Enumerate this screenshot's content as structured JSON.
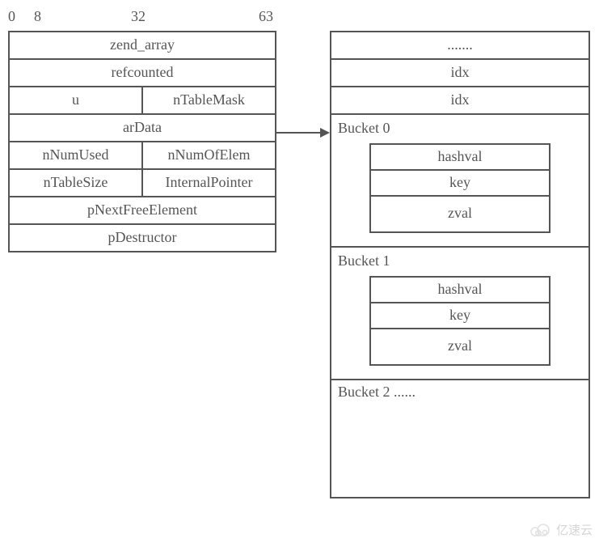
{
  "bit_labels": {
    "b0": "0",
    "b8": "8",
    "b32": "32",
    "b63": "63"
  },
  "zend_array": {
    "row0": "zend_array",
    "row1": "refcounted",
    "row2_left": "u",
    "row2_right": "nTableMask",
    "row3": "arData",
    "row4_left": "nNumUsed",
    "row4_right": "nNumOfElem",
    "row5_left": "nTableSize",
    "row5_right": "InternalPointer",
    "row6": "pNextFreeElement",
    "row7": "pDestructor"
  },
  "right": {
    "header0": ".......",
    "header1": "idx",
    "header2": "idx",
    "bucket0": {
      "title": "Bucket 0",
      "field0": "hashval",
      "field1": "key",
      "field2": "zval"
    },
    "bucket1": {
      "title": "Bucket 1",
      "field0": "hashval",
      "field1": "key",
      "field2": "zval"
    },
    "bucket2_title": "Bucket 2 ......"
  },
  "watermark": {
    "text": "亿速云"
  }
}
